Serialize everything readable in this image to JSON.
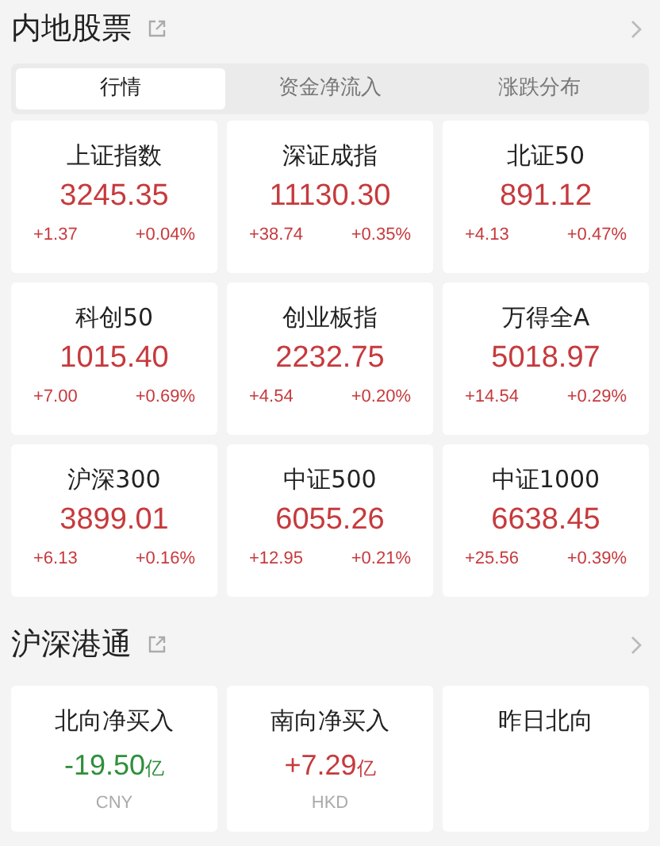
{
  "sections": [
    {
      "title": "内地股票",
      "tabs": [
        {
          "label": "行情",
          "selected": true
        },
        {
          "label": "资金净流入",
          "selected": false
        },
        {
          "label": "涨跌分布",
          "selected": false
        }
      ],
      "cards": [
        {
          "kind": "index",
          "name": "上证指数",
          "value": "3245.35",
          "change": "+1.37",
          "percent": "+0.04%",
          "color": "#c63a3d"
        },
        {
          "kind": "index",
          "name": "深证成指",
          "value": "11130.30",
          "change": "+38.74",
          "percent": "+0.35%",
          "color": "#c63a3d"
        },
        {
          "kind": "index",
          "name": "北证50",
          "value": "891.12",
          "change": "+4.13",
          "percent": "+0.47%",
          "color": "#c63a3d"
        },
        {
          "kind": "index",
          "name": "科创50",
          "value": "1015.40",
          "change": "+7.00",
          "percent": "+0.69%",
          "color": "#c63a3d"
        },
        {
          "kind": "index",
          "name": "创业板指",
          "value": "2232.75",
          "change": "+4.54",
          "percent": "+0.20%",
          "color": "#c63a3d"
        },
        {
          "kind": "index",
          "name": "万得全A",
          "value": "5018.97",
          "change": "+14.54",
          "percent": "+0.29%",
          "color": "#c63a3d"
        },
        {
          "kind": "index",
          "name": "沪深300",
          "value": "3899.01",
          "change": "+6.13",
          "percent": "+0.16%",
          "color": "#c63a3d"
        },
        {
          "kind": "index",
          "name": "中证500",
          "value": "6055.26",
          "change": "+12.95",
          "percent": "+0.21%",
          "color": "#c63a3d"
        },
        {
          "kind": "index",
          "name": "中证1000",
          "value": "6638.45",
          "change": "+25.56",
          "percent": "+0.39%",
          "color": "#c63a3d"
        }
      ]
    },
    {
      "title": "沪深港通",
      "cards": [
        {
          "kind": "flow",
          "name": "北向净买入",
          "value": "-19.50",
          "unit": "亿",
          "currency": "CNY",
          "color": "#2f8f3c"
        },
        {
          "kind": "flow",
          "name": "南向净买入",
          "value": "+7.29",
          "unit": "亿",
          "currency": "HKD",
          "color": "#c63a3d"
        },
        {
          "kind": "flow",
          "name": "昨日北向"
        }
      ]
    }
  ]
}
